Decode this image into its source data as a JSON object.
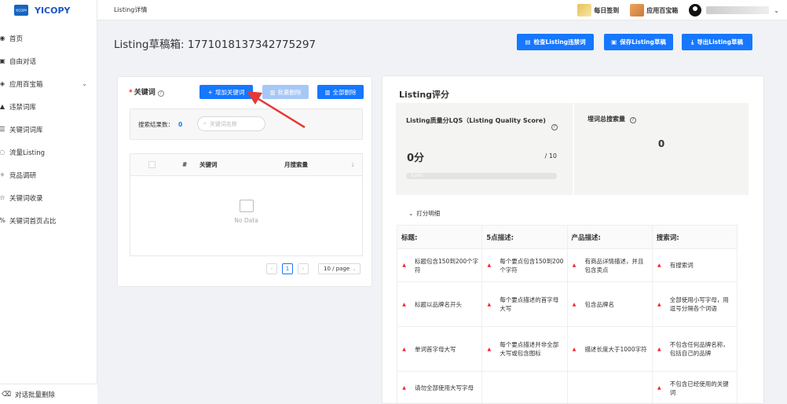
{
  "brand": {
    "name": "YICOPY",
    "mark_text": "YICOPY"
  },
  "sidebar": {
    "items": [
      {
        "label": "首页",
        "icon": "home-icon"
      },
      {
        "label": "自由对话",
        "icon": "chat-icon"
      },
      {
        "label": "应用百宝箱",
        "icon": "apps-icon"
      },
      {
        "label": "违禁词库",
        "icon": "warning-icon"
      },
      {
        "label": "关键词词库",
        "icon": "list-icon"
      },
      {
        "label": "流量Listing",
        "icon": "traffic-icon"
      },
      {
        "label": "竞品调研",
        "icon": "research-icon"
      },
      {
        "label": "关键词收录",
        "icon": "record-icon"
      },
      {
        "label": "关键词首页占比",
        "icon": "percent-icon"
      }
    ],
    "bottom_item": "对话批量删除"
  },
  "topbar": {
    "breadcrumb": "Listing详情",
    "checkin": "每日签到",
    "toolbox": "应用百宝箱"
  },
  "header": {
    "title": "Listing草稿箱: 1771018137342775297",
    "btn_check": "检查Listing违禁词",
    "btn_save": "保存Listing草稿",
    "btn_export": "导出Listing草稿"
  },
  "keywords": {
    "label": "关键词",
    "btn_add": "增加关键词",
    "btn_batch_delete": "批量删除",
    "btn_delete_all": "全部删除",
    "result_label": "搜索结果数：",
    "result_count": "0",
    "search_placeholder": "关键词名称",
    "columns": [
      "#",
      "关键词",
      "月搜索量"
    ],
    "empty_text": "No Data",
    "current_page": "1",
    "page_size": "10 / page"
  },
  "score": {
    "title": "Listing评分",
    "lqs_title": "Listing质量分LQS（Listing Quality Score)",
    "lqs_value": "0分",
    "lqs_max": "/ 10",
    "lqs_progress": 0,
    "lqs_progress_label": "0.00%",
    "search_vol_title": "埋词总搜索量",
    "search_vol_value": "0",
    "detail_toggle": "打分明细",
    "columns": [
      "标题:",
      "5点描述:",
      "产品描述:",
      "搜索词:"
    ],
    "rows": [
      [
        "标题包含150到200个字符",
        "每个要点包含150到200个字符",
        "有商品详情描述，并且包含卖点",
        "有搜索词"
      ],
      [
        "标题以品牌名开头",
        "每个要点描述的首字母大写",
        "包含品牌名",
        "全部使用小写字母，用逗号分隔各个词语"
      ],
      [
        "单词首字母大写",
        "每个要点描述并非全部大写或包含图标",
        "描述长度大于1000字符",
        "不包含任何品牌名称，包括自己的品牌"
      ],
      [
        "请勿全部使用大写字母",
        "",
        "",
        "不包含已经使用的关键词"
      ]
    ]
  },
  "colors": {
    "primary": "#1677ff",
    "danger": "#f5222d",
    "arrow": "#e53935"
  }
}
